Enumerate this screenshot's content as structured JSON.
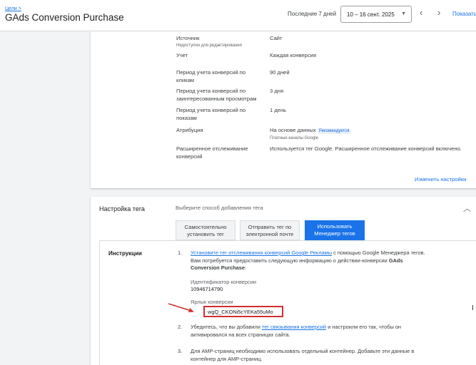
{
  "header": {
    "breadcrumb": "Цели >",
    "title": "GAds Conversion Purchase",
    "period_label": "Последние 7 дней",
    "date_range": "10 – 16 сент. 2025",
    "show_label": "Показать"
  },
  "settings": [
    {
      "key": "Источник",
      "key_sub": "Недоступно для редактирования",
      "value": "Сайт",
      "value_sub": "",
      "badge": ""
    },
    {
      "key": "Учет",
      "key_sub": "",
      "value": "Каждая конверсия",
      "value_sub": "",
      "badge": ""
    },
    {
      "key": "Период учета конверсий по кликам",
      "key_sub": "",
      "value": "90 дней",
      "value_sub": "",
      "badge": ""
    },
    {
      "key": "Период учета конверсий по заинтересованным просмотрам",
      "key_sub": "",
      "value": "3 дня",
      "value_sub": "",
      "badge": ""
    },
    {
      "key": "Период учета конверсий по показам",
      "key_sub": "",
      "value": "1 день",
      "value_sub": "",
      "badge": ""
    },
    {
      "key": "Атрибуция",
      "key_sub": "",
      "value": "На основе данных",
      "value_sub": "Платные каналы Google",
      "badge": "Рекомендуется"
    },
    {
      "key": "Расширенное отслеживание конверсий",
      "key_sub": "",
      "value": "Используется тег Google.  Расширенное отслеживание конверсий включено.",
      "value_sub": "",
      "badge": ""
    }
  ],
  "change_settings": "Изменить настройки",
  "tag_setup": {
    "title": "Настройка тега",
    "hint": "Выберите способ добавления тега",
    "options": [
      "Самостоятельно установить тег",
      "Отправить тег по электронной почте",
      "Использовать Менеджер тегов"
    ],
    "selected_index": 2
  },
  "instructions": {
    "title": "Инструкции",
    "step1": {
      "num": "1.",
      "link": "Установите тег отслеживания конверсий Google Рекламы",
      "text": " с помощью Google Менеджера тегов. Вам потребуется предоставить следующую информацию о действии-конверсии ",
      "bold": "GAds Conversion Purchase",
      "tail": ":"
    },
    "conversion_id_label": "Идентификатор конверсии",
    "conversion_id": "10946714790",
    "conversion_label_label": "Ярлык конверсии",
    "conversion_label": "wgQ_CKONi5cYEKa55uMo",
    "step2": {
      "num": "2.",
      "pre": "Убедитесь, что вы добавили ",
      "link": "тег связывания конверсий",
      "post": " и настроили его так, чтобы он активировался на всех страницах сайта."
    },
    "step3": {
      "num": "3.",
      "text": "Для AMP-страниц необходимо использовать отдельный контейнер. Добавьте эти данные в контейнер для AMP-страниц."
    }
  },
  "colors": {
    "accent": "#1a73e8",
    "highlight": "#d32f2f"
  }
}
